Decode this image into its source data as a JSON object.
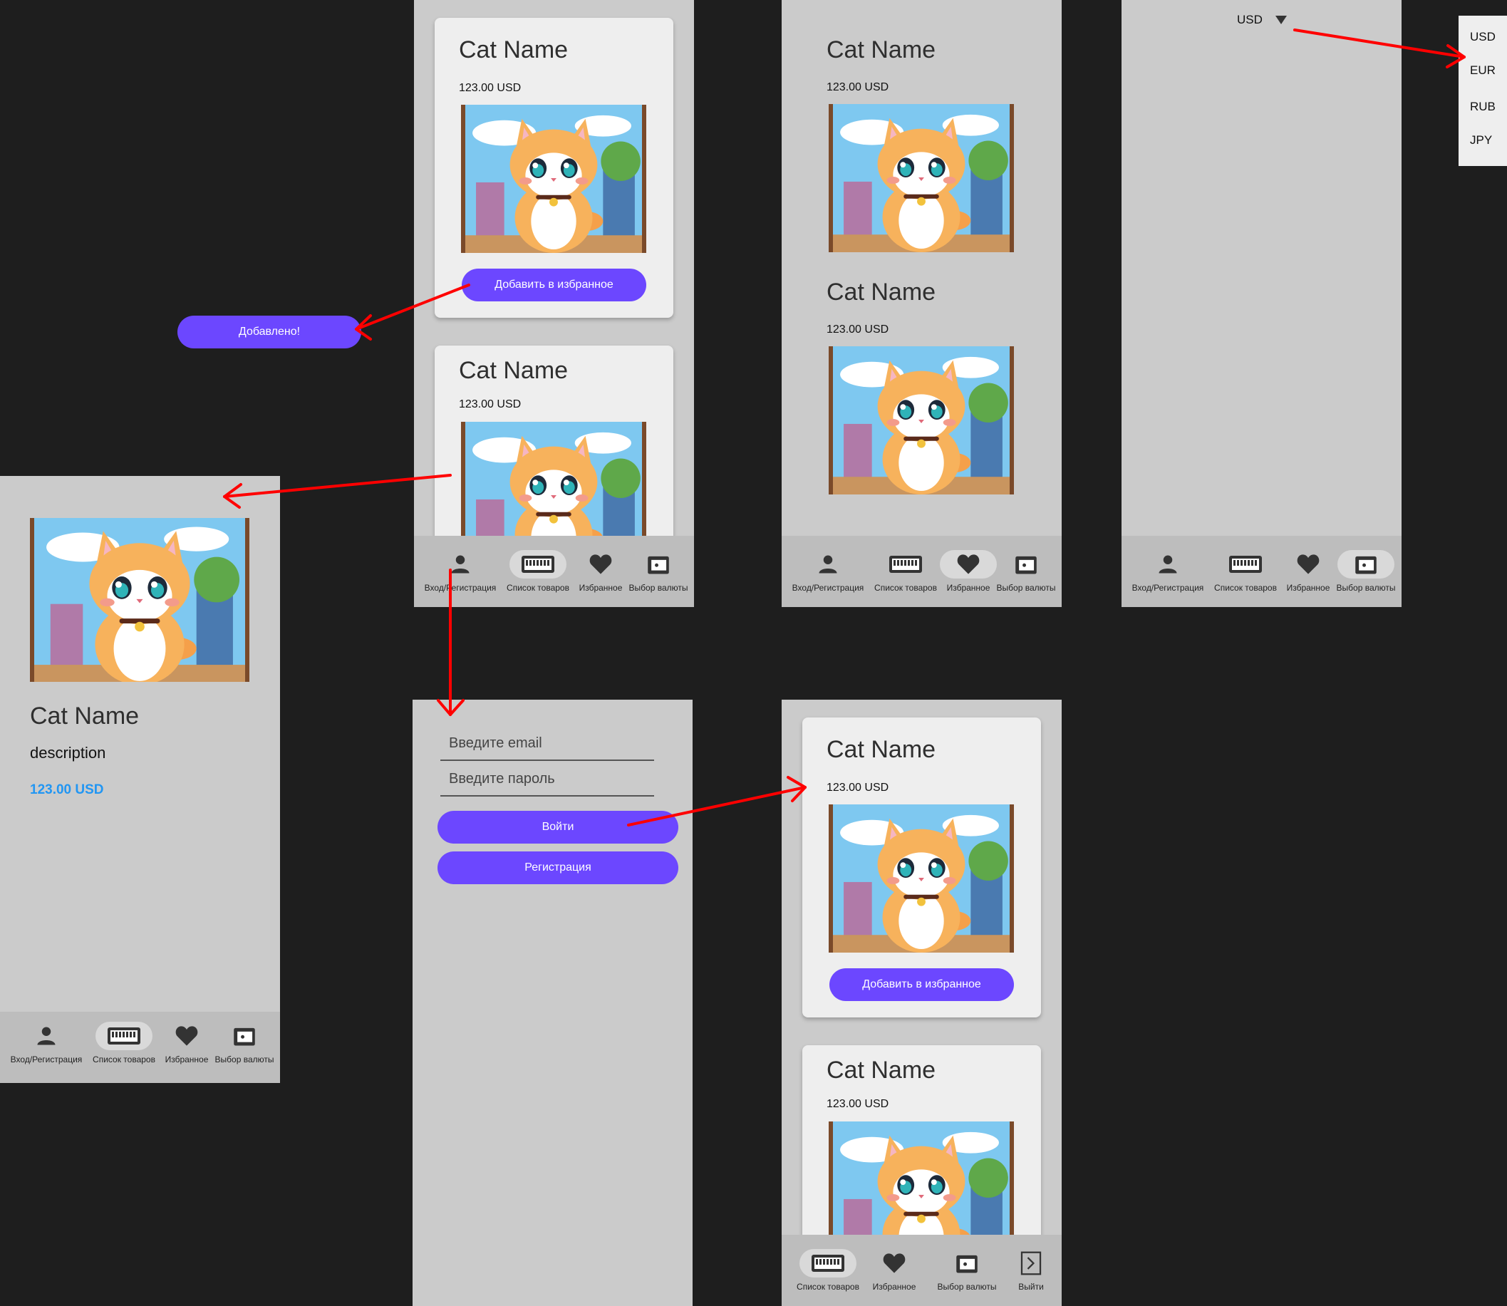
{
  "product": {
    "name": "Cat Name",
    "price": "123.00 USD",
    "description": "description",
    "add_favorite_label": "Добавить в избранное",
    "added_toast": "Добавлено!"
  },
  "nav": {
    "login": "Вход/Регистрация",
    "catalog": "Список товаров",
    "favorites": "Избранное",
    "currency": "Выбор валюты",
    "logout": "Выйти"
  },
  "login_form": {
    "email_placeholder": "Введите email",
    "password_placeholder": "Введите пароль",
    "login_button": "Войти",
    "register_button": "Регистрация"
  },
  "currency": {
    "selected": "USD",
    "options": [
      "USD",
      "EUR",
      "RUB",
      "JPY"
    ]
  },
  "colors": {
    "accent": "#6c47ff",
    "price_highlight": "#2196f3",
    "arrow": "#ff0000",
    "screen_bg": "#cbcbcb",
    "canvas_bg": "#1e1e1e"
  }
}
